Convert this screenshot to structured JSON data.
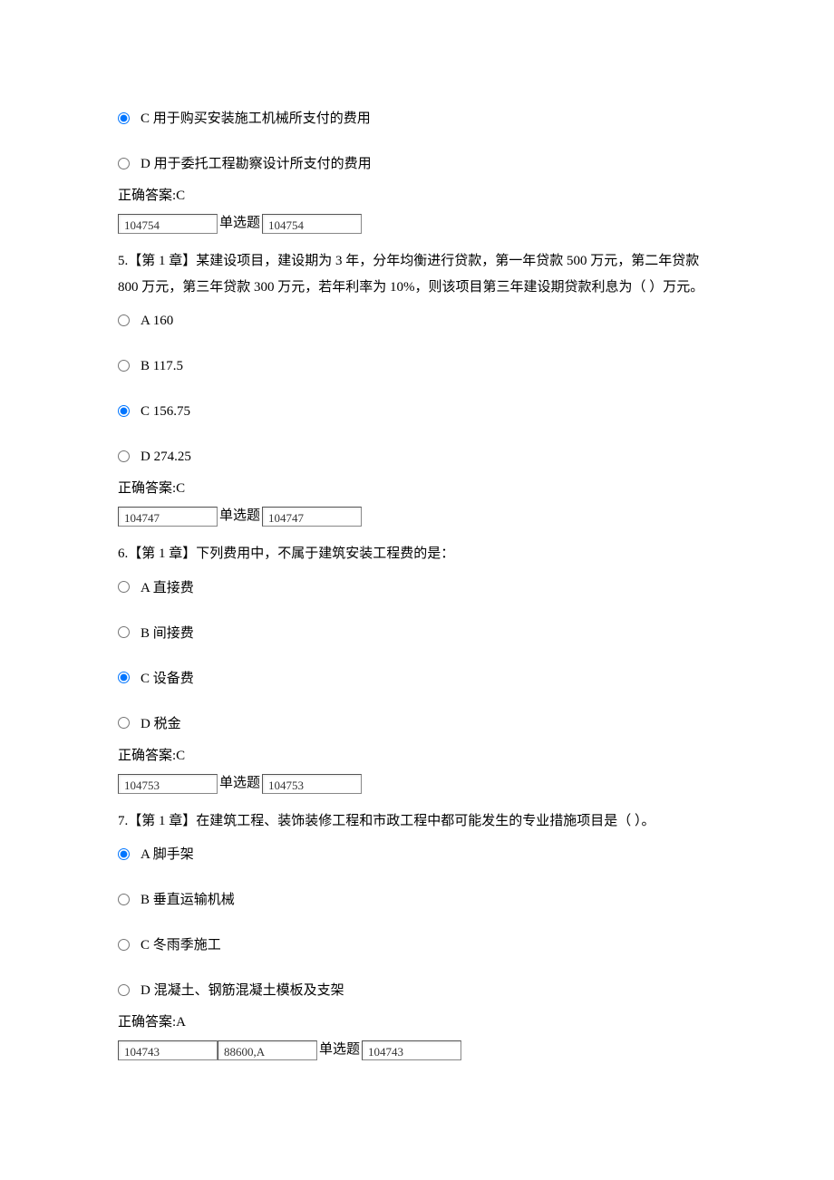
{
  "q4": {
    "optC": "C 用于购买安装施工机械所支付的费用",
    "optD": "D 用于委托工程勘察设计所支付的费用",
    "answer": "正确答案:C",
    "input1": "104754",
    "label": "单选题",
    "input2": "104754"
  },
  "q5": {
    "text": "5.【第 1 章】某建设项目，建设期为 3 年，分年均衡进行贷款，第一年贷款 500 万元，第二年贷款 800 万元，第三年贷款 300 万元，若年利率为 10%，则该项目第三年建设期贷款利息为（ ）万元。",
    "optA": "A 160",
    "optB": "B 117.5",
    "optC": "C 156.75",
    "optD": "D 274.25",
    "answer": "正确答案:C",
    "input1": "104747",
    "label": "单选题",
    "input2": "104747"
  },
  "q6": {
    "text": "6.【第 1 章】下列费用中，不属于建筑安装工程费的是：",
    "optA": "A 直接费",
    "optB": "B 间接费",
    "optC": "C 设备费",
    "optD": "D 税金",
    "answer": "正确答案:C",
    "input1": "104753",
    "label": "单选题",
    "input2": "104753"
  },
  "q7": {
    "text": "7.【第 1 章】在建筑工程、装饰装修工程和市政工程中都可能发生的专业措施项目是（ ）。",
    "optA": "A 脚手架",
    "optB": "B 垂直运输机械",
    "optC": "C 冬雨季施工",
    "optD": "D 混凝土、钢筋混凝土模板及支架",
    "answer": "正确答案:A",
    "input1": "104743",
    "input2": "88600,A",
    "label": "单选题",
    "input3": "104743"
  }
}
